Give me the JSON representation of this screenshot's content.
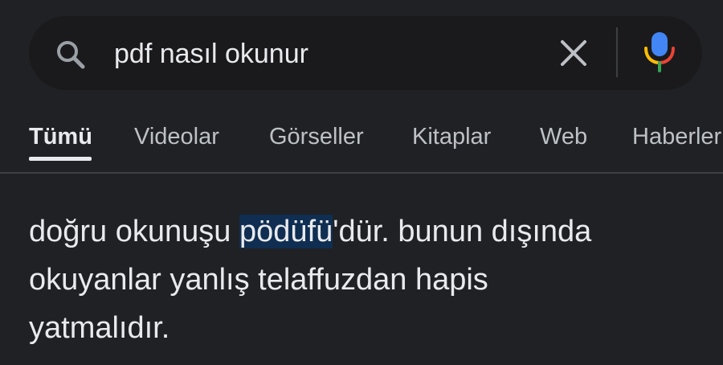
{
  "search": {
    "query": "pdf nasıl okunur"
  },
  "tabs": [
    {
      "label": "Tümü",
      "active": true
    },
    {
      "label": "Videolar",
      "active": false
    },
    {
      "label": "Görseller",
      "active": false
    },
    {
      "label": "Kitaplar",
      "active": false
    },
    {
      "label": "Web",
      "active": false
    },
    {
      "label": "Haberler",
      "active": false
    }
  ],
  "answer": {
    "line1_before": "doğru okunuşu ",
    "line1_highlight": "pödüfü",
    "line1_after": "'dür. bunun dışında",
    "line2": "okuyanlar yanlış telaffuzdan hapis",
    "line3": "yatmalıdır."
  },
  "colors": {
    "background": "#202124",
    "highlight": "#0f2e52",
    "mic_blue": "#4285f4",
    "mic_red": "#ea4335",
    "mic_yellow": "#fbbc05",
    "mic_green": "#34a853"
  },
  "icons": [
    "search-icon",
    "clear-icon",
    "microphone-icon"
  ]
}
